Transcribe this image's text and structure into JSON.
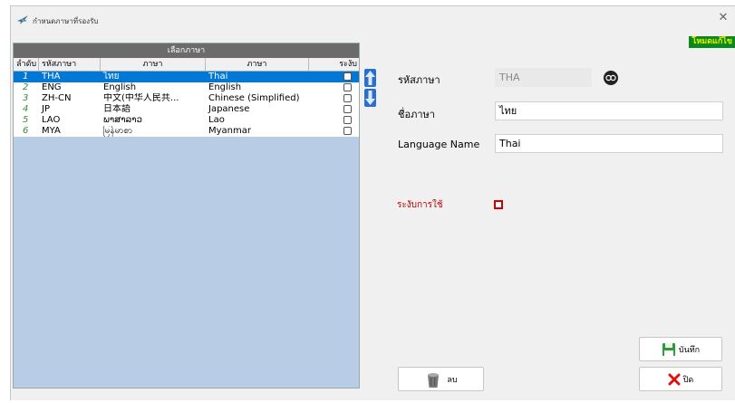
{
  "window": {
    "title": "กำหนดภาษาที่รองรับ",
    "mode_badge": "โหมดแก้ไข"
  },
  "grid": {
    "caption": "เลือกภาษา",
    "headers": {
      "no": "ลำดับ",
      "code": "รหัสภาษา",
      "name_th": "ภาษา",
      "name_en": "ภาษา",
      "active": "ระงับ"
    },
    "rows": [
      {
        "no": "1",
        "code": "THA",
        "name_th": "ไทย",
        "name_en": "Thai",
        "selected": true
      },
      {
        "no": "2",
        "code": "ENG",
        "name_th": "English",
        "name_en": "English"
      },
      {
        "no": "3",
        "code": "ZH-CN",
        "name_th": "中文(中华人民共...",
        "name_en": "Chinese (Simplified)"
      },
      {
        "no": "4",
        "code": "JP",
        "name_th": "日本語",
        "name_en": "Japanese"
      },
      {
        "no": "5",
        "code": "LAO",
        "name_th": "ພາສາລາວ",
        "name_en": "Lao"
      },
      {
        "no": "6",
        "code": "MYA",
        "name_th": "မြန်မာစာ",
        "name_en": "Myanmar"
      }
    ]
  },
  "form": {
    "code_label": "รหัสภาษา",
    "code_value": "THA",
    "name_label": "ชื่อภาษา",
    "name_value": "ไทย",
    "lang_name_label": "Language Name",
    "lang_name_value": "Thai",
    "status_label": "ระงับการใช้"
  },
  "buttons": {
    "delete": "ลบ",
    "save": "บันทึก",
    "close": "ปิด"
  },
  "icons": {
    "app": "bird-icon",
    "close": "close-icon",
    "up": "arrow-up-icon",
    "down": "arrow-down-icon",
    "search": "search-icon",
    "delete": "trash-icon",
    "save": "save-icon",
    "exit": "x-icon"
  },
  "colors": {
    "selected_row": "#0078d7",
    "grid_bg": "#b8cde5",
    "badge_bg": "#0a8a1e",
    "badge_text": "#e8f000",
    "status_red": "#c00000",
    "row_no_green": "#3a8a3a"
  }
}
